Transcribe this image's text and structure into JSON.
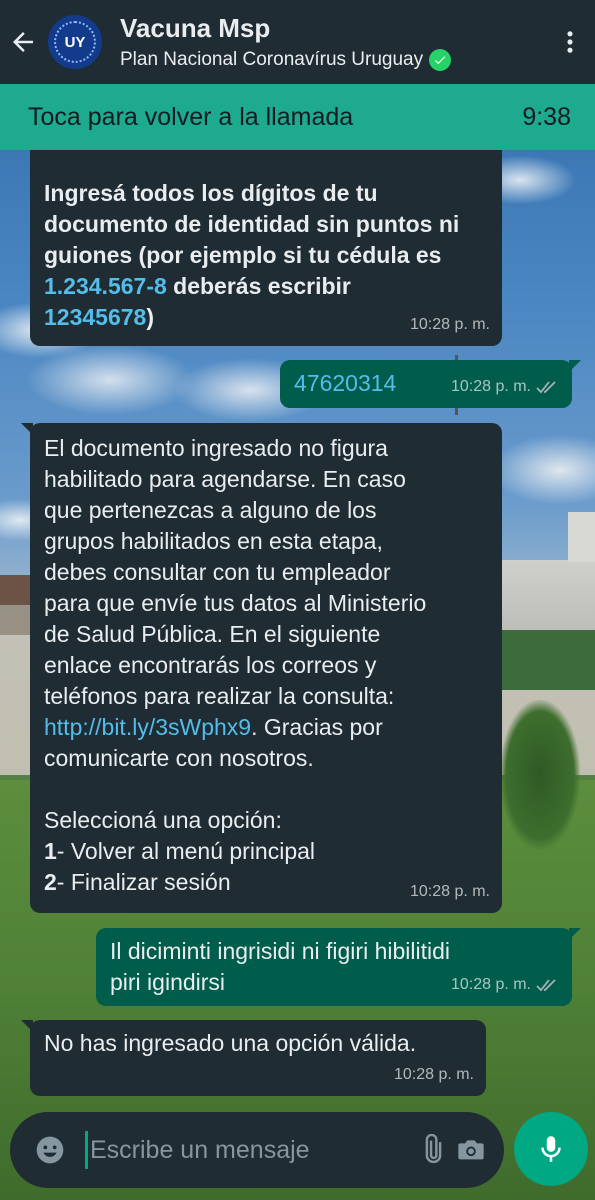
{
  "header": {
    "contact_name": "Vacuna Msp",
    "subtitle": "Plan Nacional Coronavírus Uruguay",
    "avatar_text": "UY"
  },
  "call_banner": {
    "text": "Toca para volver a la llamada",
    "duration": "9:38"
  },
  "messages": [
    {
      "direction": "incoming",
      "lines": [
        "Ingresá todos los dígitos de tu",
        "documento de identidad sin puntos ni",
        "guiones (por ejemplo si tu cédula es",
        "1.234.567-8",
        " deberás escribir",
        "12345678",
        ")"
      ],
      "time": "10:28 p. m."
    },
    {
      "direction": "outgoing",
      "text": "47620314",
      "time": "10:28 p. m."
    },
    {
      "direction": "incoming",
      "lines": [
        "El documento ingresado no figura",
        "habilitado para agendarse. En caso",
        "que pertenezcas a alguno de los",
        "grupos habilitados en esta etapa,",
        "debes consultar con tu empleador",
        "para que envíe tus datos al Ministerio",
        "de Salud Pública. En el siguiente",
        "enlace encontrarás los correos y",
        "teléfonos para realizar la consulta:",
        "http://bit.ly/3sWphx9",
        ". Gracias por",
        "comunicarte con nosotros.",
        "Seleccioná una opción:",
        "1",
        "- Volver al menú principal",
        "2",
        "- Finalizar sesión"
      ],
      "time": "10:28 p. m."
    },
    {
      "direction": "outgoing",
      "lines": [
        "Il diciminti ingrisidi ni figiri hibilitidi",
        "piri igindirsi"
      ],
      "time": "10:28 p. m."
    },
    {
      "direction": "incoming",
      "text": "No has ingresado una opción válida.",
      "time": "10:28 p. m."
    }
  ],
  "composer": {
    "placeholder": "Escribe un mensaje"
  },
  "icons": {
    "back": "arrow-left-icon",
    "menu": "more-vertical-icon",
    "verified": "verified-badge-icon",
    "emoji": "emoji-icon",
    "attach": "paperclip-icon",
    "camera": "camera-icon",
    "mic": "microphone-icon",
    "read_receipt": "double-check-icon"
  },
  "colors": {
    "header": "#1f2c33",
    "call_banner": "#1daa8e",
    "incoming_bubble": "#1f2c33",
    "outgoing_bubble": "#005c4b",
    "link": "#53bdeb",
    "accent": "#00a884"
  }
}
